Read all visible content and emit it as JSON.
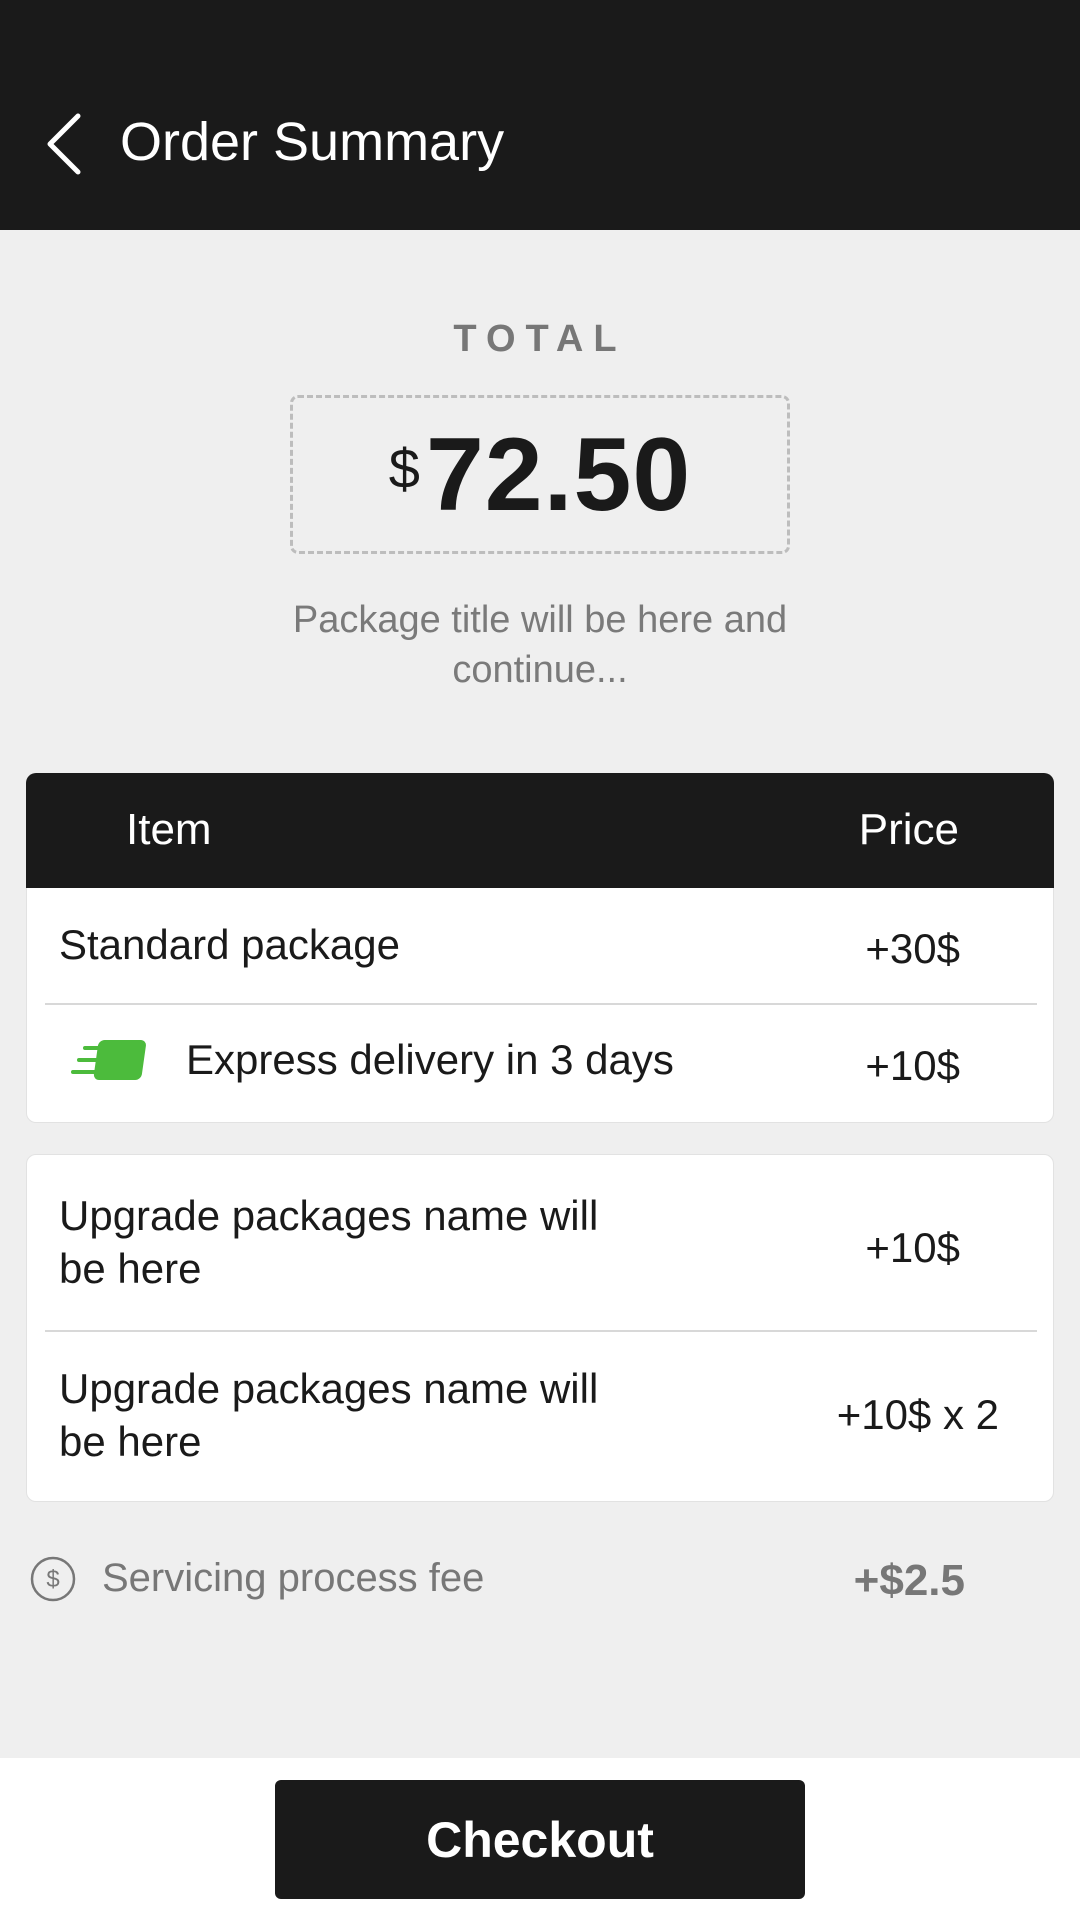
{
  "header": {
    "title": "Order Summary",
    "back_icon": "chevron-left-icon"
  },
  "total": {
    "label": "TOTAL",
    "currency": "$",
    "amount": "72.50"
  },
  "package_title": "Package title will be here and continue...",
  "table": {
    "col_item": "Item",
    "col_price": "Price",
    "base_rows": [
      {
        "label": "Standard package",
        "price": "+30$"
      },
      {
        "label": "Express delivery in 3 days",
        "price": "+10$",
        "icon": "express-delivery-icon"
      }
    ],
    "upgrade_rows": [
      {
        "label": "Upgrade packages name will be here",
        "price": "+10$"
      },
      {
        "label": "Upgrade packages name will be here",
        "price": "+10$ x 2"
      }
    ]
  },
  "fee": {
    "label": "Servicing process fee",
    "price": "+$2.5",
    "icon": "dollar-circle-icon"
  },
  "checkout": {
    "label": "Checkout"
  },
  "colors": {
    "dark": "#1a1a1a",
    "background": "#efefef",
    "accent_green": "#4cbb3c",
    "muted": "#777777"
  }
}
